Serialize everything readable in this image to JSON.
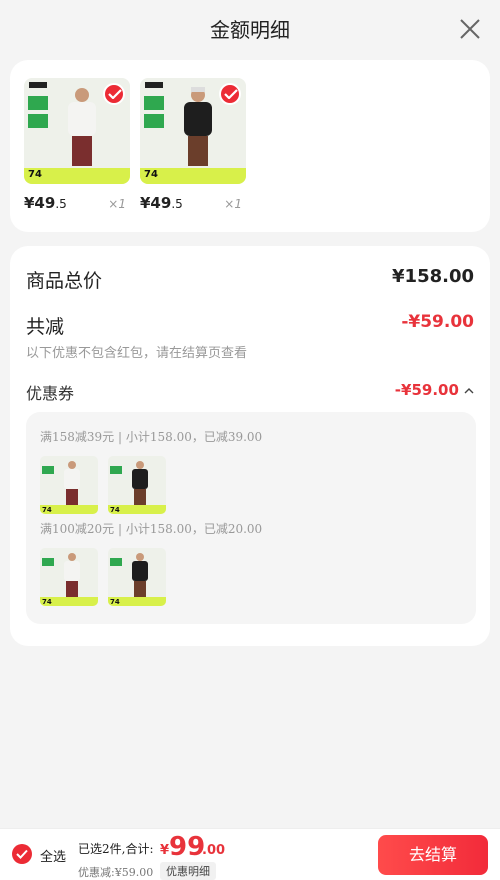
{
  "header": {
    "title": "金额明细"
  },
  "products": [
    {
      "price_int": "¥49",
      "price_dec": ".5",
      "qty": "×1",
      "badge": "74",
      "shirt_color": "#f4f4f2",
      "pants_color": "#7a2e2e"
    },
    {
      "price_int": "¥49",
      "price_dec": ".5",
      "qty": "×1",
      "badge": "74",
      "shirt_color": "#1e1e1e",
      "pants_color": "#6b3e2b"
    }
  ],
  "summary": {
    "total_label": "商品总价",
    "total_value": "¥158.00",
    "discount_label": "共减",
    "discount_value": "-¥59.00",
    "note": "以下优惠不包含红包，请在结算页查看",
    "coupon_label": "优惠券",
    "coupon_value": "-¥59.00"
  },
  "coupons": [
    {
      "text": "满158减39元 | 小计158.00，已减39.00"
    },
    {
      "text": "满100减20元 | 小计158.00，已减20.00"
    }
  ],
  "footer": {
    "select_all": "全选",
    "selected_summary": "已选2件,合计:",
    "currency": "¥",
    "pay_int": "99",
    "pay_dec": ".00",
    "saved": "优惠减:¥59.00",
    "detail_button": "优惠明细",
    "checkout_button": "去结算"
  },
  "colors": {
    "accent": "#ec2b35",
    "discount": "#e8333b",
    "badge_bar": "#d8f04a",
    "green": "#2fa84f"
  }
}
